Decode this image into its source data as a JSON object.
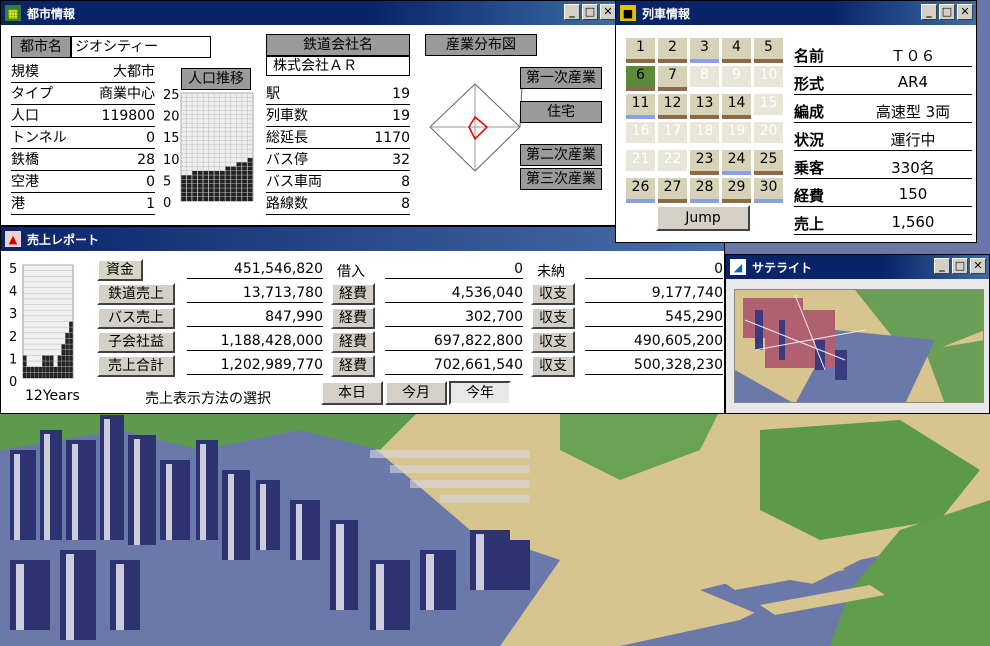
{
  "city_window": {
    "title": "都市情報",
    "city_name_label": "都市名",
    "city_name_value": "ジオシティー",
    "stats": [
      {
        "label": "規模",
        "value": "大都市"
      },
      {
        "label": "タイプ",
        "value": "商業中心"
      },
      {
        "label": "人口",
        "value": "119800"
      },
      {
        "label": "トンネル",
        "value": "0"
      },
      {
        "label": "鉄橋",
        "value": "28"
      },
      {
        "label": "空港",
        "value": "0"
      },
      {
        "label": "港",
        "value": "1"
      }
    ],
    "pop_chart": {
      "title": "人口推移",
      "ticks": [
        "25",
        "20",
        "15",
        "10",
        "5",
        "0"
      ],
      "values": [
        6,
        6,
        7,
        7,
        7,
        7,
        7,
        7,
        8,
        8,
        9,
        9,
        10
      ]
    },
    "company_label": "鉄道会社名",
    "company_value": "株式会社ＡＲ",
    "company_stats": [
      {
        "label": "駅",
        "value": "19"
      },
      {
        "label": "列車数",
        "value": "19"
      },
      {
        "label": "総延長",
        "value": "1170"
      },
      {
        "label": "バス停",
        "value": "32"
      },
      {
        "label": "バス車両",
        "value": "8"
      },
      {
        "label": "路線数",
        "value": "8"
      }
    ],
    "industry_title": "産業分布図",
    "industry_labels": [
      "第一次産業",
      "住宅",
      "第二次産業",
      "第三次産業"
    ]
  },
  "train_window": {
    "title": "列車情報",
    "cells": [
      {
        "n": "1",
        "bar": "brown",
        "active": true
      },
      {
        "n": "2",
        "bar": "brown",
        "active": true
      },
      {
        "n": "3",
        "bar": "blue",
        "active": true
      },
      {
        "n": "4",
        "bar": "brown",
        "active": true
      },
      {
        "n": "5",
        "bar": "brown",
        "active": true
      },
      {
        "n": "6",
        "bar": "brown",
        "active": true,
        "selected": true
      },
      {
        "n": "7",
        "bar": "brown",
        "active": true
      },
      {
        "n": "8",
        "bar": "",
        "active": false
      },
      {
        "n": "9",
        "bar": "",
        "active": false
      },
      {
        "n": "10",
        "bar": "",
        "active": false
      },
      {
        "n": "11",
        "bar": "blue",
        "active": true
      },
      {
        "n": "12",
        "bar": "brown",
        "active": true
      },
      {
        "n": "13",
        "bar": "brown",
        "active": true
      },
      {
        "n": "14",
        "bar": "brown",
        "active": true
      },
      {
        "n": "15",
        "bar": "",
        "active": false
      },
      {
        "n": "16",
        "bar": "",
        "active": false
      },
      {
        "n": "17",
        "bar": "",
        "active": false
      },
      {
        "n": "18",
        "bar": "",
        "active": false
      },
      {
        "n": "19",
        "bar": "",
        "active": false
      },
      {
        "n": "20",
        "bar": "",
        "active": false
      },
      {
        "n": "21",
        "bar": "",
        "active": false
      },
      {
        "n": "22",
        "bar": "",
        "active": false
      },
      {
        "n": "23",
        "bar": "brown",
        "active": true
      },
      {
        "n": "24",
        "bar": "blue",
        "active": true
      },
      {
        "n": "25",
        "bar": "brown",
        "active": true
      },
      {
        "n": "26",
        "bar": "blue",
        "active": true
      },
      {
        "n": "27",
        "bar": "brown",
        "active": true
      },
      {
        "n": "28",
        "bar": "blue",
        "active": true
      },
      {
        "n": "29",
        "bar": "brown",
        "active": true
      },
      {
        "n": "30",
        "bar": "blue",
        "active": true
      }
    ],
    "jump_label": "Jump",
    "info": [
      {
        "label": "名前",
        "value": "Ｔ０６"
      },
      {
        "label": "形式",
        "value": "AR4"
      },
      {
        "label": "編成",
        "value": "高速型 3両"
      },
      {
        "label": "状況",
        "value": "運行中"
      },
      {
        "label": "乗客",
        "value": "330名"
      },
      {
        "label": "経費",
        "value": "150"
      },
      {
        "label": "売上",
        "value": "1,560"
      }
    ]
  },
  "sales_window": {
    "title": "売上レポート",
    "chart": {
      "ticks": [
        "5",
        "4",
        "3",
        "2",
        "1",
        "0"
      ],
      "values": [
        1,
        0.5,
        0.5,
        0.5,
        0.5,
        1,
        1,
        1,
        0.5,
        1,
        1.5,
        2,
        2.5
      ],
      "xlabel": "12Years"
    },
    "rows": [
      {
        "label": "資金",
        "value": "451,546,820",
        "mid_label": "借入",
        "mid_value": "0",
        "right_label": "未納",
        "right_value": "0"
      },
      {
        "label": "鉄道売上",
        "value": "13,713,780",
        "mid_label": "経費",
        "mid_value": "4,536,040",
        "right_label": "収支",
        "right_value": "9,177,740"
      },
      {
        "label": "バス売上",
        "value": "847,990",
        "mid_label": "経費",
        "mid_value": "302,700",
        "right_label": "収支",
        "right_value": "545,290"
      },
      {
        "label": "子会社益",
        "value": "1,188,428,000",
        "mid_label": "経費",
        "mid_value": "697,822,800",
        "right_label": "収支",
        "right_value": "490,605,200"
      },
      {
        "label": "売上合計",
        "value": "1,202,989,770",
        "mid_label": "経費",
        "mid_value": "702,661,540",
        "right_label": "収支",
        "right_value": "500,328,230"
      }
    ],
    "mode_label": "売上表示方法の選択",
    "mode_buttons": [
      "本日",
      "今月",
      "今年"
    ]
  },
  "satellite_window": {
    "title": "サテライト"
  },
  "colors": {
    "title_bar": "#0a246a",
    "bar_brown": "#8b6a4a",
    "bar_blue": "#8aa0e0",
    "cell_active": "#d6d2b8",
    "cell_selected": "#5a8a3a"
  }
}
